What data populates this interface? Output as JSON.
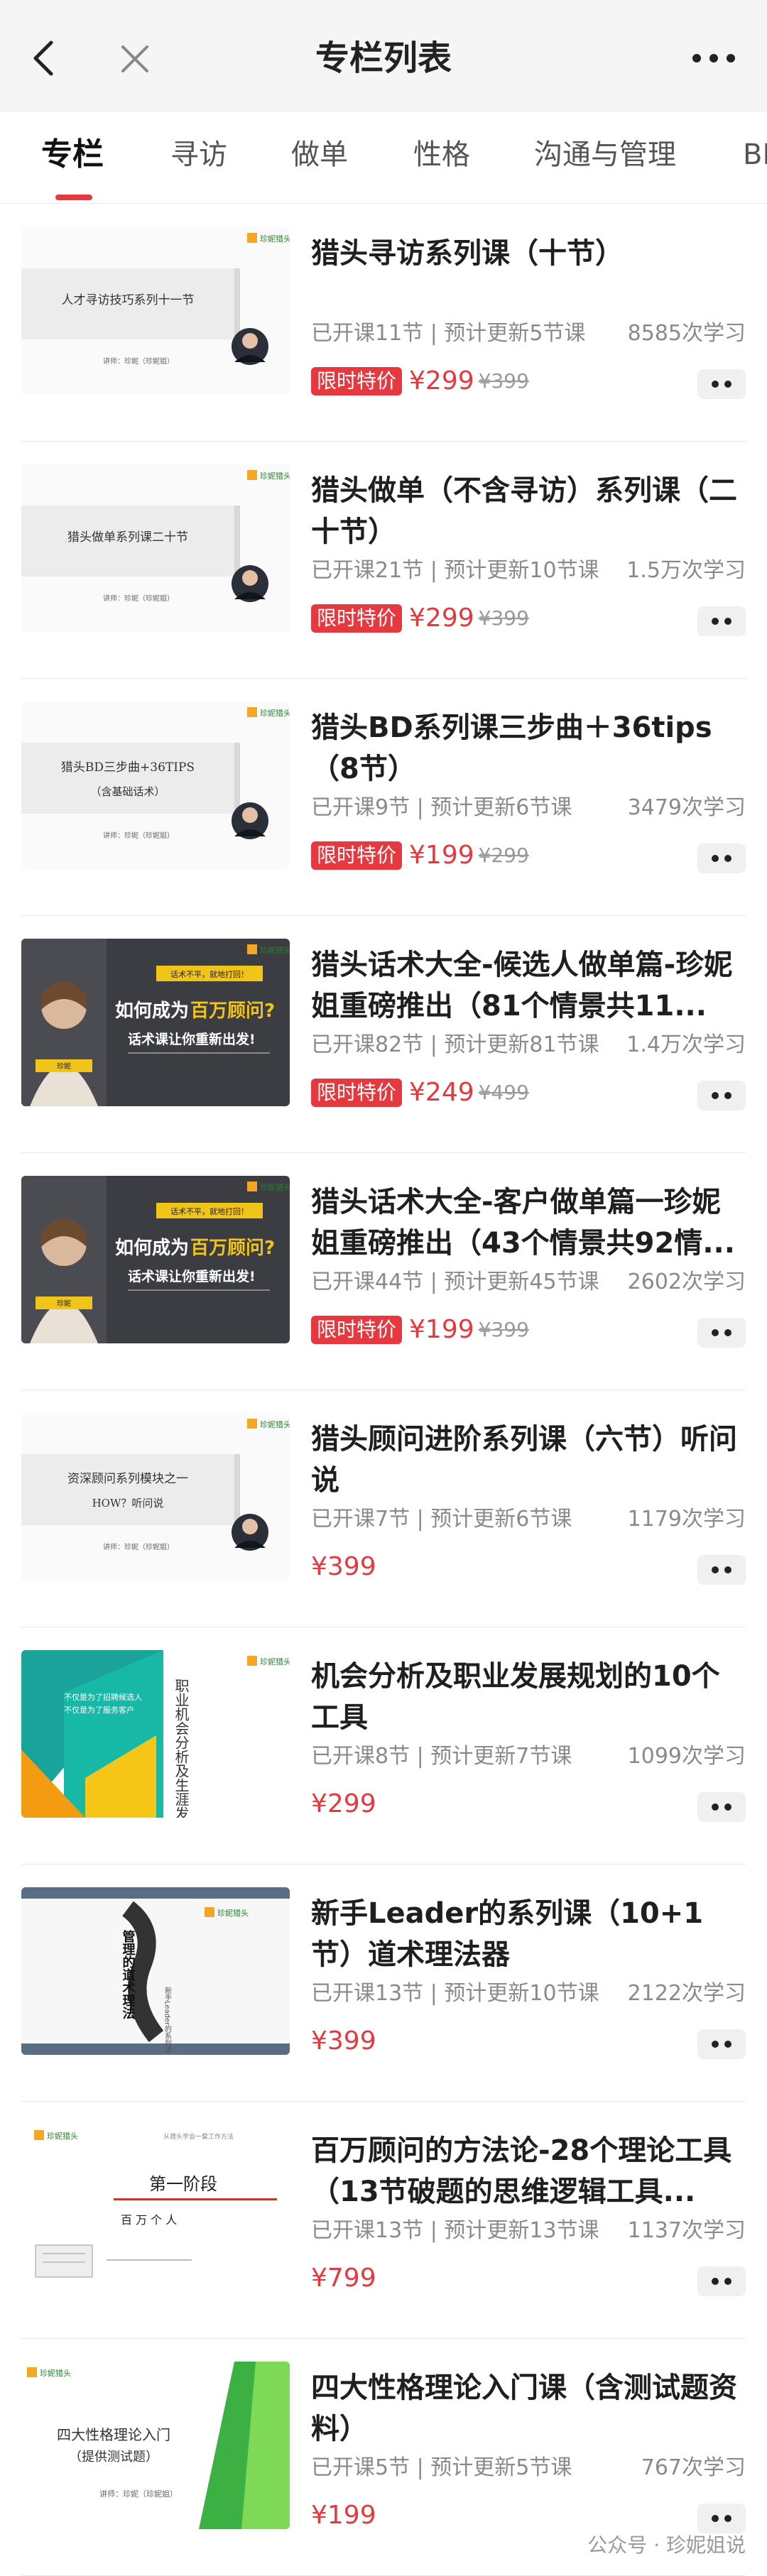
{
  "header": {
    "title": "专栏列表"
  },
  "tabs": [
    "专栏",
    "寻访",
    "做单",
    "性格",
    "沟通与管理",
    "BD"
  ],
  "items": [
    {
      "title": "猎头寻访系列课（十节）",
      "lessons": "已开课11节",
      "update": "预计更新5节课",
      "study": "8585次学习",
      "badge": "限时特价",
      "price": "¥299",
      "orig": "¥399",
      "thumb": {
        "kind": "scroll",
        "text": "人才寻访技巧系列十一节",
        "sub": "讲师：珍妮（珍妮姐）",
        "logo": "珍妮猎头"
      }
    },
    {
      "title": "猎头做单（不含寻访）系列课（二十节）",
      "lessons": "已开课21节",
      "update": "预计更新10节课",
      "study": "1.5万次学习",
      "badge": "限时特价",
      "price": "¥299",
      "orig": "¥399",
      "thumb": {
        "kind": "scroll",
        "text": "猎头做单系列课二十节",
        "sub": "讲师：珍妮（珍妮姐）",
        "logo": "珍妮猎头"
      }
    },
    {
      "title": "猎头BD系列课三步曲＋36tips（8节）",
      "lessons": "已开课9节",
      "update": "预计更新6节课",
      "study": "3479次学习",
      "badge": "限时特价",
      "price": "¥199",
      "orig": "¥299",
      "thumb": {
        "kind": "scroll",
        "text": "猎头BD三步曲+36TIPS",
        "text2": "（含基础话术）",
        "sub": "讲师：珍妮（珍妮姐）",
        "logo": "珍妮猎头"
      }
    },
    {
      "title": "猎头话术大全-候选人做单篇-珍妮姐重磅推出（81个情景共11...",
      "lessons": "已开课82节",
      "update": "预计更新81节课",
      "study": "1.4万次学习",
      "badge": "限时特价",
      "price": "¥249",
      "orig": "¥499",
      "thumb": {
        "kind": "dark",
        "tag": "话术不平，就地打回！",
        "line1a": "如何成为",
        "line1b": "百万顾问?",
        "line2": "话术课让你重新出发!",
        "logo": "珍妮猎头"
      }
    },
    {
      "title": "猎头话术大全-客户做单篇一珍妮姐重磅推出（43个情景共92情...",
      "lessons": "已开课44节",
      "update": "预计更新45节课",
      "study": "2602次学习",
      "badge": "限时特价",
      "price": "¥199",
      "orig": "¥399",
      "thumb": {
        "kind": "dark",
        "tag": "话术不平，就地打回！",
        "line1a": "如何成为",
        "line1b": "百万顾问?",
        "line2": "话术课让你重新出发!",
        "logo": "珍妮猎头"
      }
    },
    {
      "title": "猎头顾问进阶系列课（六节）听问说",
      "lessons": "已开课7节",
      "update": "预计更新6节课",
      "study": "1179次学习",
      "badge": "",
      "price": "¥399",
      "orig": "",
      "thumb": {
        "kind": "scroll",
        "text": "资深顾问系列模块之一",
        "text2": "HOW？听问说",
        "sub": "讲师：珍妮（珍妮姐）",
        "logo": "珍妮猎头"
      }
    },
    {
      "title": "机会分析及职业发展规划的10个工具",
      "lessons": "已开课8节",
      "update": "预计更新7节课",
      "study": "1099次学习",
      "badge": "",
      "price": "¥299",
      "orig": "",
      "thumb": {
        "kind": "geo",
        "text": "职业机会分析及生涯发展规划中的工具",
        "s1": "不仅是为了招聘候选人",
        "s2": "不仅是为了服务客户",
        "logo": "珍妮猎头"
      }
    },
    {
      "title": "新手Leader的系列课（10+1节）道术理法器",
      "lessons": "已开课13节",
      "update": "预计更新10节课",
      "study": "2122次学习",
      "badge": "",
      "price": "¥399",
      "orig": "",
      "thumb": {
        "kind": "brush",
        "text": "管理的道术理法",
        "sub": "新手Leader的系列课",
        "logo": "珍妮猎头"
      }
    },
    {
      "title": "百万顾问的方法论-28个理论工具（13节破题的思维逻辑工具...",
      "lessons": "已开课13节",
      "update": "预计更新13节课",
      "study": "1137次学习",
      "badge": "",
      "price": "¥799",
      "orig": "",
      "thumb": {
        "kind": "stage",
        "text": "第一阶段",
        "text2": "百  万  个  人",
        "top": "从猎头学会一套工作方法",
        "logo": "珍妮猎头"
      }
    },
    {
      "title": "四大性格理论入门课（含测试题资料）",
      "lessons": "已开课5节",
      "update": "预计更新5节课",
      "study": "767次学习",
      "badge": "",
      "price": "¥199",
      "orig": "",
      "thumb": {
        "kind": "green",
        "text": "四大性格理论入门",
        "text2": "（提供测试题）",
        "sub": "讲师：珍妮（珍妮姐）",
        "logo": "珍妮猎头"
      }
    }
  ],
  "watermark": "公众号 · 珍妮姐说",
  "colors": {
    "accent": "#e6393f",
    "topbar": "#f5f5f5"
  }
}
